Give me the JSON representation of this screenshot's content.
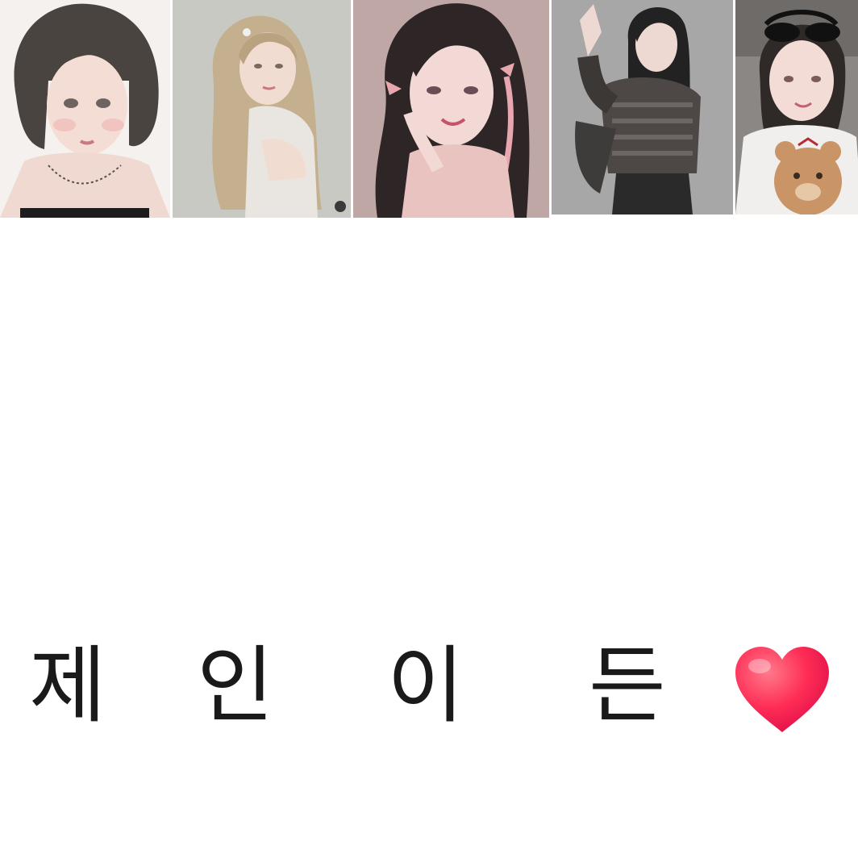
{
  "gallery": {
    "images": [
      {
        "name": "short-dark-hair-portrait"
      },
      {
        "name": "long-blonde-hair-portrait"
      },
      {
        "name": "long-dark-hair-bows-portrait"
      },
      {
        "name": "peace-sign-striped-sweater-portrait"
      },
      {
        "name": "sunglasses-teddy-bear-portrait"
      }
    ]
  },
  "caption": {
    "chars": [
      "제",
      "인",
      "이",
      "든"
    ],
    "emoji": "heart-icon"
  },
  "colors": {
    "heart": "#ff2d55",
    "text": "#1a1a1a"
  }
}
